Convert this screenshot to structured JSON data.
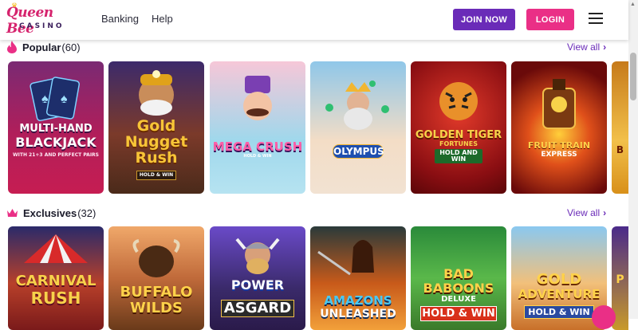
{
  "header": {
    "logo_top": "Queen Bee",
    "logo_bottom": "CASINO",
    "nav": [
      "Banking",
      "Help"
    ],
    "join_label": "JOIN NOW",
    "login_label": "LOGIN"
  },
  "sections": [
    {
      "title": "Popular",
      "count": "(60)",
      "view_all": "View all",
      "games": [
        {
          "name": "MULTI-HAND BLACKJACK",
          "line1": "MULTI-HAND",
          "line2": "BLACKJACK",
          "sub": "WITH 21+3 AND PERFECT PAIRS"
        },
        {
          "name": "Gold Nugget Rush",
          "line1": "Gold",
          "line2": "Nugget",
          "line3": "Rush",
          "sub": "HOLD & WIN"
        },
        {
          "name": "MEGA CRUSH",
          "line1": "MEGA CRUSH",
          "sub": "HOLD & WIN"
        },
        {
          "name": "WAYS OF OLYMPUS",
          "line1": "OLYMPUS"
        },
        {
          "name": "GOLDEN TIGER FORTUNES",
          "line1": "GOLDEN TIGER",
          "line2": "FORTUNES",
          "sub": "HOLD AND WIN"
        },
        {
          "name": "FRUIT TRAIN EXPRESS",
          "line1": "FRUIT TRAIN",
          "line2": "EXPRESS"
        },
        {
          "name": "B"
        }
      ]
    },
    {
      "title": "Exclusives",
      "count": "(32)",
      "view_all": "View all",
      "games": [
        {
          "name": "CARNIVAL RUSH",
          "line1": "CARNIVAL",
          "line2": "RUSH"
        },
        {
          "name": "BUFFALO WILDS",
          "line1": "BUFFALO",
          "line2": "WILDS"
        },
        {
          "name": "POWER OF ASGARD",
          "line1": "POWER",
          "line2": "ASGARD"
        },
        {
          "name": "AMAZONS UNLEASHED",
          "line1": "AMAZONS",
          "line2": "UNLEASHED"
        },
        {
          "name": "BAD BABOONS DELUXE HOLD & WIN",
          "line1": "BAD",
          "line2": "BABOONS",
          "sub": "DELUXE",
          "line3": "HOLD & WIN"
        },
        {
          "name": "GOLD ADVENTURE HOLD & WIN",
          "line1": "GOLD",
          "line2": "ADVENTURE",
          "line3": "HOLD & WIN"
        },
        {
          "name": "P"
        }
      ]
    }
  ],
  "colors": {
    "brand_purple": "#6a2bb8",
    "brand_pink": "#ea2f86",
    "logo_pink": "#d6246e"
  }
}
